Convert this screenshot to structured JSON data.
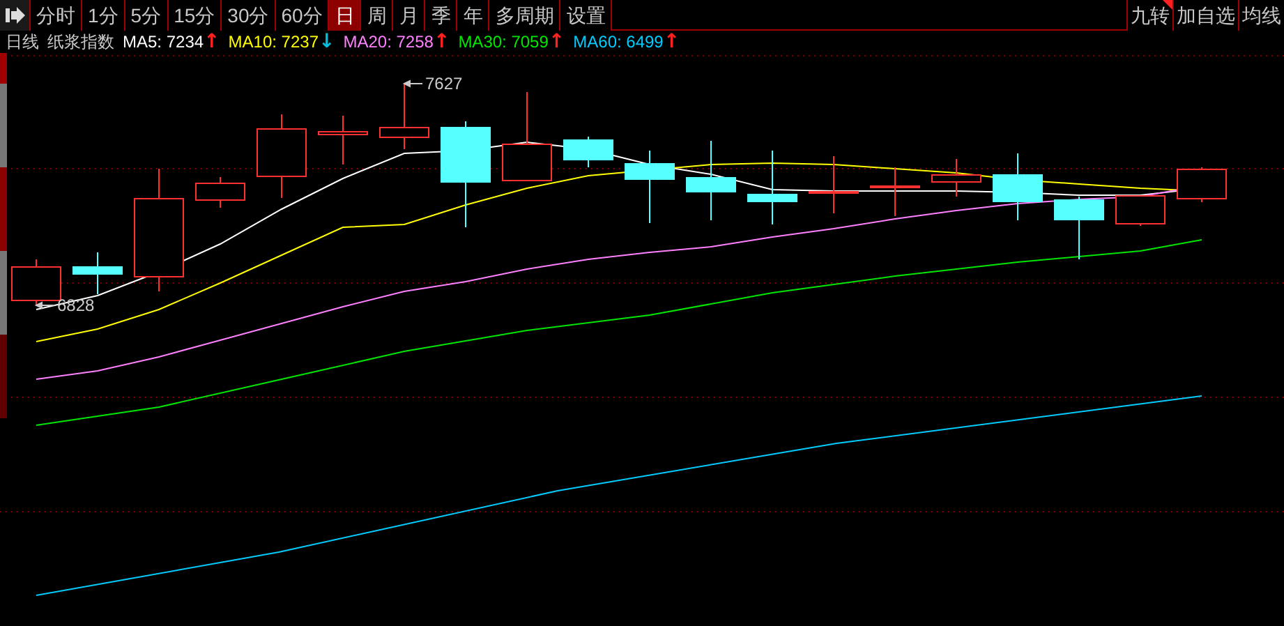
{
  "toolbar": {
    "periods": [
      {
        "label": "分时",
        "selected": false
      },
      {
        "label": "1分",
        "selected": false
      },
      {
        "label": "5分",
        "selected": false
      },
      {
        "label": "15分",
        "selected": false
      },
      {
        "label": "30分",
        "selected": false
      },
      {
        "label": "60分",
        "selected": false
      },
      {
        "label": "日",
        "selected": true
      },
      {
        "label": "周",
        "selected": false
      },
      {
        "label": "月",
        "selected": false
      },
      {
        "label": "季",
        "selected": false
      },
      {
        "label": "年",
        "selected": false
      },
      {
        "label": "多周期",
        "selected": false
      },
      {
        "label": "设置",
        "selected": false
      }
    ],
    "right_buttons": [
      {
        "label": "九转",
        "flagged": true
      },
      {
        "label": "加自选",
        "flagged": false
      },
      {
        "label": "均线",
        "flagged": false
      }
    ]
  },
  "legend": {
    "period": "日线",
    "name": "纸浆指数",
    "averages": [
      {
        "label": "MA5: 7234",
        "arrow": {
          "text": "↑",
          "color": "#ff2020"
        },
        "color": "#ffffff"
      },
      {
        "label": "MA10: 7237",
        "arrow": {
          "text": "↓",
          "color": "#00c0e0"
        },
        "color": "#ffff00"
      },
      {
        "label": "MA20: 7258",
        "arrow": {
          "text": "↑",
          "color": "#ff2020"
        },
        "color": "#ff80ff"
      },
      {
        "label": "MA30: 7059",
        "arrow": {
          "text": "↑",
          "color": "#ff2020"
        },
        "color": "#00e600"
      },
      {
        "label": "MA60: 6499",
        "arrow": {
          "text": "↑",
          "color": "#ff2020"
        },
        "color": "#00ccff"
      }
    ]
  },
  "chart": {
    "high_label": "7627",
    "low_label": "6828"
  }
}
